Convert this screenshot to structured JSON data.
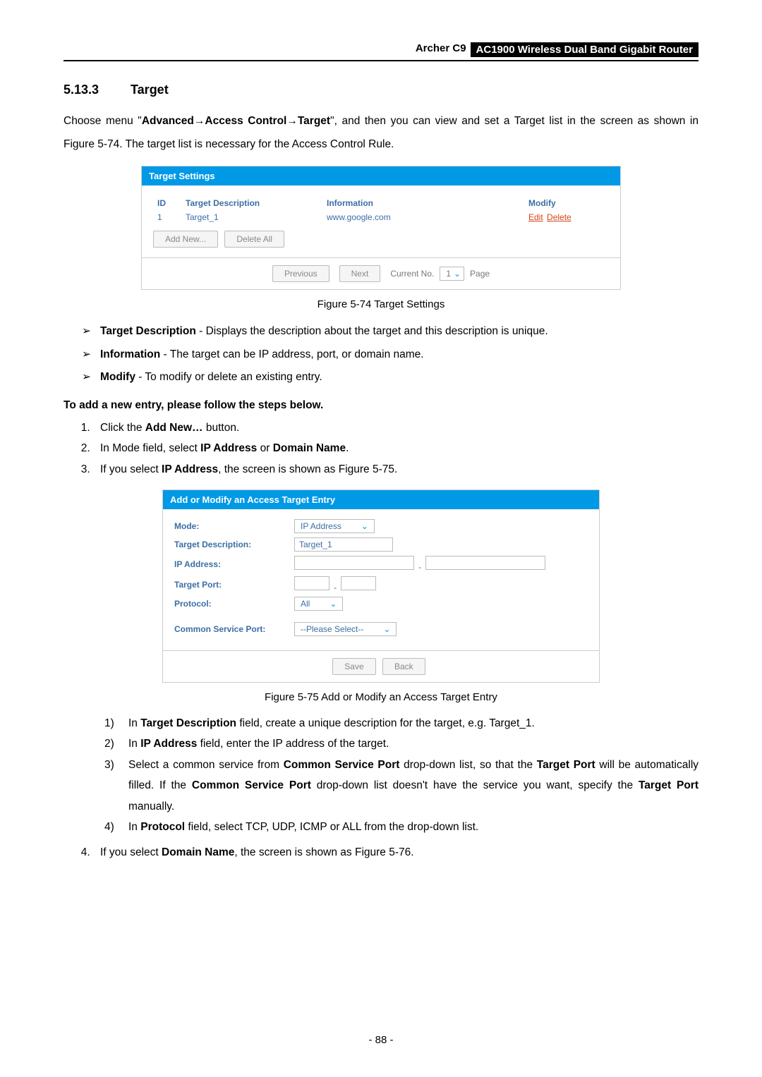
{
  "header": {
    "model": "Archer C9",
    "title": "AC1900 Wireless Dual Band Gigabit Router"
  },
  "section": {
    "number": "5.13.3",
    "title": "Target"
  },
  "para1_pre": "Choose menu \"",
  "para1_nav1": "Advanced",
  "para1_nav2": "Access Control",
  "para1_nav3": "Target",
  "para1_post": "\", and then you can view and set a Target list in the screen as shown in Figure 5-74. The target list is necessary for the Access Control Rule.",
  "panel1": {
    "title": "Target Settings",
    "cols": {
      "id": "ID",
      "desc": "Target Description",
      "info": "Information",
      "mod": "Modify"
    },
    "row": {
      "id": "1",
      "desc": "Target_1",
      "info": "www.google.com",
      "edit": "Edit",
      "delete": "Delete"
    },
    "addnew": "Add New...",
    "deleteall": "Delete All",
    "prev": "Previous",
    "next": "Next",
    "curno": "Current No.",
    "curval": "1",
    "page": "Page"
  },
  "fig1": "Figure 5-74 Target Settings",
  "bullets": {
    "b1_label": "Target Description",
    "b1_text": " - Displays the description about the target and this description is unique.",
    "b2_label": "Information",
    "b2_text": " - The target can be IP address, port, or domain name.",
    "b3_label": "Modify",
    "b3_text": " - To modify or delete an existing entry."
  },
  "steps_head": "To add a new entry, please follow the steps below.",
  "steps": {
    "s1_pre": "Click the ",
    "s1_bold": "Add New…",
    "s1_post": " button.",
    "s2_pre": "In Mode field, select ",
    "s2_b1": "IP Address",
    "s2_mid": " or ",
    "s2_b2": "Domain Name",
    "s2_post": ".",
    "s3_pre": "If you select ",
    "s3_bold": "IP Address",
    "s3_post": ", the screen is shown as Figure 5-75."
  },
  "panel2": {
    "title": "Add or Modify an Access Target Entry",
    "mode_lbl": "Mode:",
    "mode_val": "IP Address",
    "desc_lbl": "Target Description:",
    "desc_val": "Target_1",
    "ip_lbl": "IP Address:",
    "port_lbl": "Target Port:",
    "proto_lbl": "Protocol:",
    "proto_val": "All",
    "csp_lbl": "Common Service Port:",
    "csp_val": "--Please Select--",
    "save": "Save",
    "back": "Back"
  },
  "fig2": "Figure 5-75 Add or Modify an Access Target Entry",
  "substeps": {
    "a_n": "1)",
    "a_pre": "In ",
    "a_bold": "Target Description",
    "a_post": " field, create a unique description for the target, e.g. Target_1.",
    "b_n": "2)",
    "b_pre": "In ",
    "b_bold": "IP Address",
    "b_post": " field, enter the IP address of the target.",
    "c_n": "3)",
    "c_pre": "Select a common service from ",
    "c_b1": "Common Service Port",
    "c_mid": " drop-down list, so that the ",
    "c_b2": "Target Port",
    "c_mid2": " will be automatically filled. If the ",
    "c_b3": "Common Service Port",
    "c_mid3": " drop-down list doesn't have the service you want, specify the ",
    "c_b4": "Target Port",
    "c_post": " manually.",
    "d_n": "4)",
    "d_pre": "In ",
    "d_bold": "Protocol",
    "d_post": " field, select TCP, UDP, ICMP or ALL from the drop-down list."
  },
  "step4_pre": "If you select ",
  "step4_bold": "Domain Name",
  "step4_post": ", the screen is shown as Figure 5-76.",
  "page_footer": "- 88 -"
}
